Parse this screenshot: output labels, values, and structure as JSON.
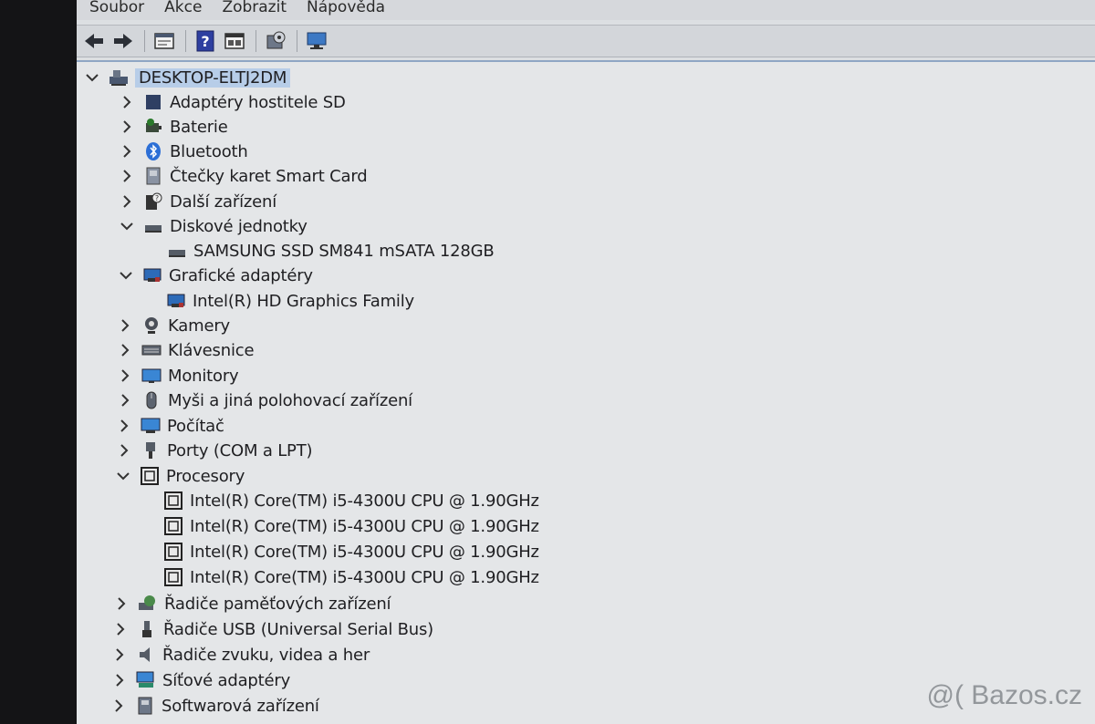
{
  "menu": [
    "Soubor",
    "Akce",
    "Zobrazit",
    "Nápověda"
  ],
  "toolbar": {
    "icons": [
      "back-arrow-icon",
      "forward-arrow-icon",
      "properties-icon",
      "help-icon",
      "view-icon",
      "update-driver-icon",
      "monitor-scan-icon"
    ]
  },
  "tree": {
    "root": "DESKTOP-ELTJ2DM",
    "nodes": [
      {
        "label": "Adaptéry hostitele SD",
        "expanded": false
      },
      {
        "label": "Baterie",
        "expanded": false
      },
      {
        "label": "Bluetooth",
        "expanded": false
      },
      {
        "label": "Čtečky karet Smart Card",
        "expanded": false
      },
      {
        "label": "Další zařízení",
        "expanded": false
      },
      {
        "label": "Diskové jednotky",
        "expanded": true
      },
      {
        "label": "SAMSUNG SSD SM841 mSATA 128GB",
        "child": true
      },
      {
        "label": "Grafické adaptéry",
        "expanded": true
      },
      {
        "label": "Intel(R) HD Graphics Family",
        "child": true
      },
      {
        "label": "Kamery",
        "expanded": false
      },
      {
        "label": "Klávesnice",
        "expanded": false
      },
      {
        "label": "Monitory",
        "expanded": false
      },
      {
        "label": "Myši a jiná polohovací zařízení",
        "expanded": false
      },
      {
        "label": "Počítač",
        "expanded": false
      },
      {
        "label": "Porty (COM a LPT)",
        "expanded": false
      },
      {
        "label": "Procesory",
        "expanded": true
      },
      {
        "label": "Intel(R) Core(TM) i5-4300U CPU @ 1.90GHz",
        "child": true
      },
      {
        "label": "Intel(R) Core(TM) i5-4300U CPU @ 1.90GHz",
        "child": true
      },
      {
        "label": "Intel(R) Core(TM) i5-4300U CPU @ 1.90GHz",
        "child": true
      },
      {
        "label": "Intel(R) Core(TM) i5-4300U CPU @ 1.90GHz",
        "child": true
      },
      {
        "label": "Řadiče paměťových zařízení",
        "expanded": false
      },
      {
        "label": "Řadiče USB (Universal Serial Bus)",
        "expanded": false
      },
      {
        "label": "Řadiče zvuku, videa a her",
        "expanded": false
      },
      {
        "label": "Síťové adaptéry",
        "expanded": false
      },
      {
        "label": "Softwarová zařízení",
        "expanded": false
      }
    ]
  },
  "watermark": "@( Bazos.cz"
}
